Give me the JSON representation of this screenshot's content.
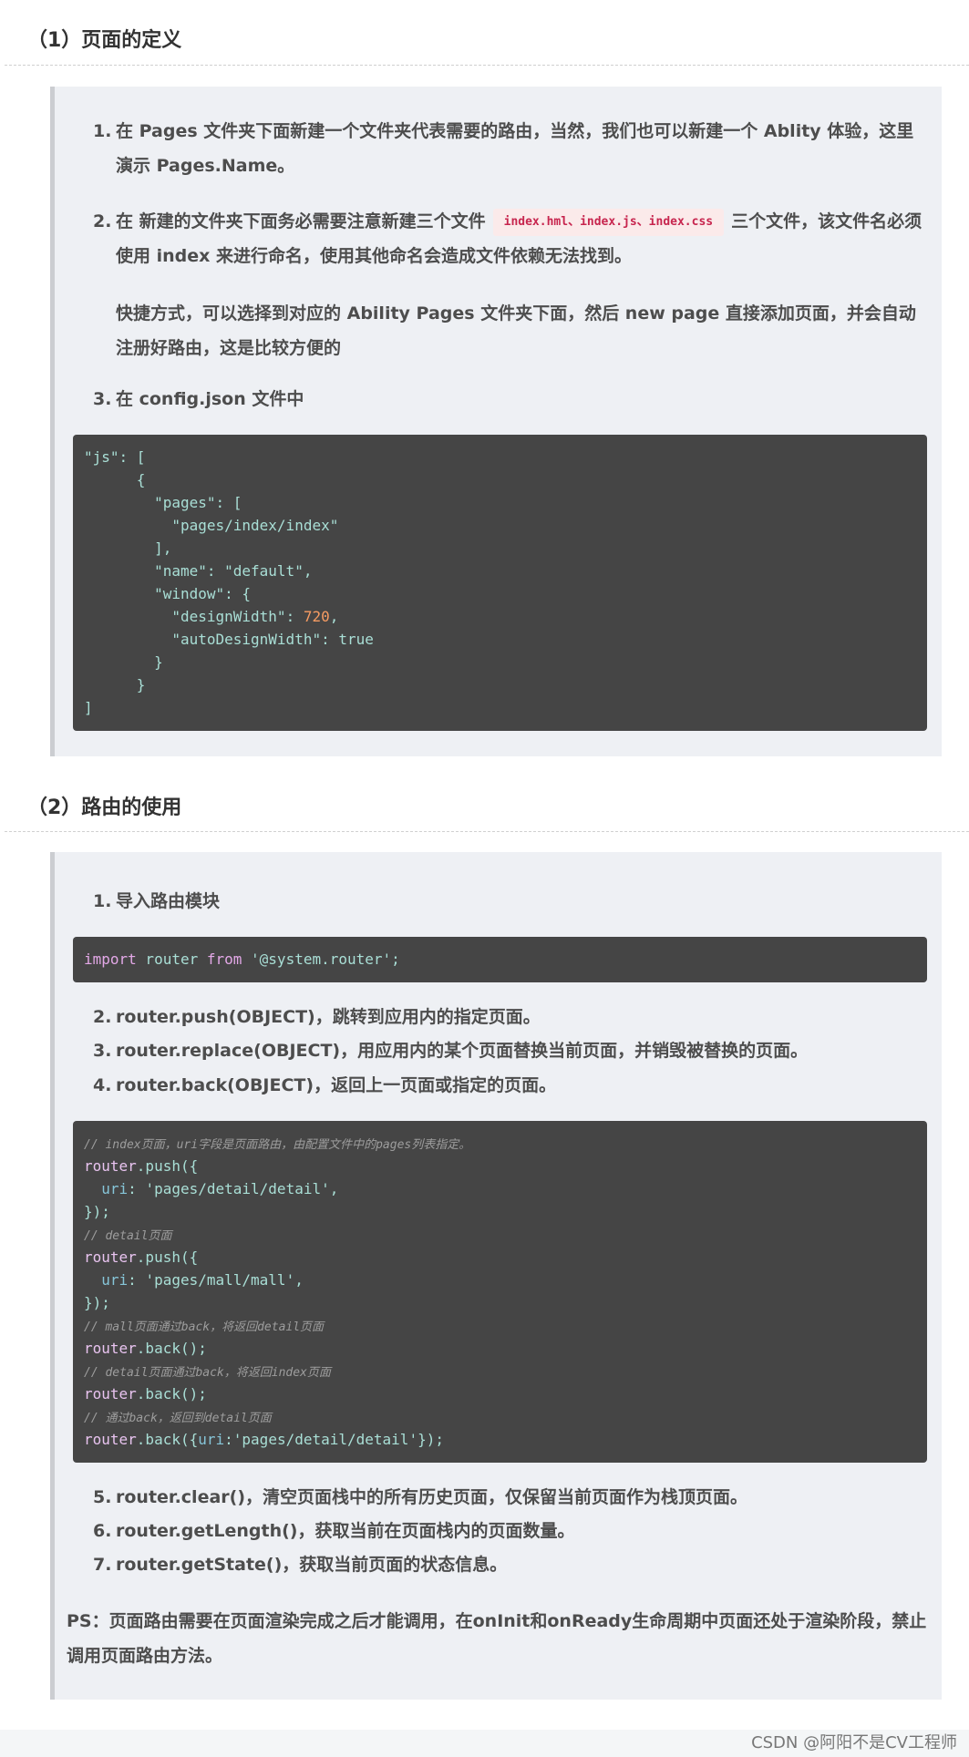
{
  "section1": {
    "heading": "（1）页面的定义",
    "items": [
      {
        "num": "1.",
        "text": "在 Pages 文件夹下面新建一个文件夹代表需要的路由，当然，我们也可以新建一个 Ablity 体验，这里演示 Pages.Name。"
      },
      {
        "num": "2.",
        "text_before": "在 新建的文件夹下面务必需要注意新建三个文件",
        "code": "index.hml、index.js、index.css",
        "text_after": "三个文件，该文件名必须使用 index 来进行命名，使用其他命名会造成文件依赖无法找到。"
      },
      {
        "num": "3.",
        "text": "在 config.json 文件中"
      }
    ],
    "note": "快捷方式，可以选择到对应的 Ability Pages 文件夹下面，然后 new page 直接添加页面，并会自动注册好路由，这是比较方便的",
    "code_lines": [
      [
        {
          "t": "\"js\"",
          "c": "t-str"
        },
        {
          "t": ": [",
          "c": "t-plain"
        }
      ],
      [
        {
          "t": "      {",
          "c": "t-plain"
        }
      ],
      [
        {
          "t": "        \"pages\"",
          "c": "t-str"
        },
        {
          "t": ": [",
          "c": "t-plain"
        }
      ],
      [
        {
          "t": "          \"pages/index/index\"",
          "c": "t-str"
        }
      ],
      [
        {
          "t": "        ],",
          "c": "t-plain"
        }
      ],
      [
        {
          "t": "        \"name\"",
          "c": "t-str"
        },
        {
          "t": ": ",
          "c": "t-plain"
        },
        {
          "t": "\"default\"",
          "c": "t-str"
        },
        {
          "t": ",",
          "c": "t-plain"
        }
      ],
      [
        {
          "t": "        \"window\"",
          "c": "t-str"
        },
        {
          "t": ": {",
          "c": "t-plain"
        }
      ],
      [
        {
          "t": "          \"designWidth\"",
          "c": "t-str"
        },
        {
          "t": ": ",
          "c": "t-plain"
        },
        {
          "t": "720",
          "c": "t-num"
        },
        {
          "t": ",",
          "c": "t-plain"
        }
      ],
      [
        {
          "t": "          \"autoDesignWidth\"",
          "c": "t-str"
        },
        {
          "t": ": ",
          "c": "t-plain"
        },
        {
          "t": "true",
          "c": "t-lit"
        }
      ],
      [
        {
          "t": "        }",
          "c": "t-plain"
        }
      ],
      [
        {
          "t": "      }",
          "c": "t-plain"
        }
      ],
      [
        {
          "t": "]",
          "c": "t-plain"
        }
      ]
    ]
  },
  "section2": {
    "heading": "（2）路由的使用",
    "item1": {
      "num": "1.",
      "text": "导入路由模块"
    },
    "import_line": [
      {
        "t": "import",
        "c": "t-kw"
      },
      {
        "t": " router ",
        "c": "t-plain"
      },
      {
        "t": "from",
        "c": "t-kw"
      },
      {
        "t": " ",
        "c": "t-plain"
      },
      {
        "t": "'@system.router'",
        "c": "t-str"
      },
      {
        "t": ";",
        "c": "t-plain"
      }
    ],
    "items_mid": [
      {
        "num": "2.",
        "text": "router.push(OBJECT)，跳转到应用内的指定页面。"
      },
      {
        "num": "3.",
        "text": "router.replace(OBJECT)，用应用内的某个页面替换当前页面，并销毁被替换的页面。"
      },
      {
        "num": "4.",
        "text": "router.back(OBJECT)，返回上一页面或指定的页面。"
      }
    ],
    "code_lines": [
      [
        {
          "t": "// index页面，uri字段是页面路由，由配置文件中的pages列表指定。",
          "c": "t-com"
        }
      ],
      [
        {
          "t": "router",
          "c": "t-fn"
        },
        {
          "t": ".push({",
          "c": "t-plain"
        }
      ],
      [
        {
          "t": "  uri",
          "c": "t-prop"
        },
        {
          "t": ": ",
          "c": "t-plain"
        },
        {
          "t": "'pages/detail/detail'",
          "c": "t-str"
        },
        {
          "t": ",",
          "c": "t-plain"
        }
      ],
      [
        {
          "t": "});",
          "c": "t-plain"
        }
      ],
      [
        {
          "t": "// detail页面",
          "c": "t-com"
        }
      ],
      [
        {
          "t": "router",
          "c": "t-fn"
        },
        {
          "t": ".push({",
          "c": "t-plain"
        }
      ],
      [
        {
          "t": "  uri",
          "c": "t-prop"
        },
        {
          "t": ": ",
          "c": "t-plain"
        },
        {
          "t": "'pages/mall/mall'",
          "c": "t-str"
        },
        {
          "t": ",",
          "c": "t-plain"
        }
      ],
      [
        {
          "t": "});",
          "c": "t-plain"
        }
      ],
      [
        {
          "t": "// mall页面通过back，将返回detail页面",
          "c": "t-com"
        }
      ],
      [
        {
          "t": "router",
          "c": "t-fn"
        },
        {
          "t": ".back();",
          "c": "t-plain"
        }
      ],
      [
        {
          "t": "// detail页面通过back，将返回index页面",
          "c": "t-com"
        }
      ],
      [
        {
          "t": "router",
          "c": "t-fn"
        },
        {
          "t": ".back();",
          "c": "t-plain"
        }
      ],
      [
        {
          "t": "// 通过back，返回到detail页面",
          "c": "t-com"
        }
      ],
      [
        {
          "t": "router",
          "c": "t-fn"
        },
        {
          "t": ".back({",
          "c": "t-plain"
        },
        {
          "t": "uri",
          "c": "t-prop"
        },
        {
          "t": ":",
          "c": "t-plain"
        },
        {
          "t": "'pages/detail/detail'",
          "c": "t-str"
        },
        {
          "t": "});",
          "c": "t-plain"
        }
      ]
    ],
    "items_end": [
      {
        "num": "5.",
        "text": "router.clear()，清空页面栈中的所有历史页面，仅保留当前页面作为栈顶页面。"
      },
      {
        "num": "6.",
        "text": "router.getLength()，获取当前在页面栈内的页面数量。"
      },
      {
        "num": "7.",
        "text": "router.getState()，获取当前页面的状态信息。"
      }
    ],
    "ps": "PS：页面路由需要在页面渲染完成之后才能调用，在onInit和onReady生命周期中页面还处于渲染阶段，禁止调用页面路由方法。"
  },
  "watermark": "CSDN @阿阳不是CV工程师"
}
